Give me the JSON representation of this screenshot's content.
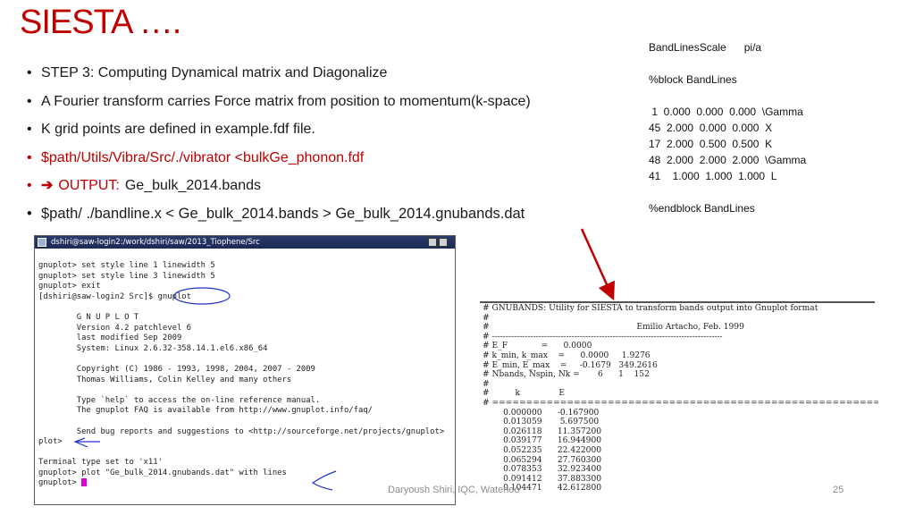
{
  "slide": {
    "title": "SIESTA ….",
    "footer": "Daryoush Shiri, IQC, Waterloo",
    "page_number": "25",
    "accent_color": "#c00000"
  },
  "bullets": [
    "STEP 3: Computing Dynamical matrix and Diagonalize",
    "A Fourier transform carries Force matrix from position to momentum(k-space)",
    "K grid points are defined in example.fdf file.",
    "$path/Utils/Vibra/Src/./vibrator <bulkGe_phonon.fdf",
    "$path/ ./bandline.x < Ge_bulk_2014.bands > Ge_bulk_2014.gnubands.dat"
  ],
  "output_bullet": {
    "arrow_icon": "arrow-right-icon",
    "label": "OUTPUT:",
    "value": "Ge_bulk_2014.bands"
  },
  "fdf_block": {
    "lines": [
      "BandLinesScale      pi/a",
      "",
      "%block BandLines",
      "",
      " 1  0.000  0.000  0.000  \\Gamma",
      "45  2.000  0.000  0.000  X",
      "17  2.000  0.500  0.500  K",
      "48  2.000  2.000  2.000  \\Gamma",
      "41    1.000  1.000  1.000  L",
      "",
      "%endblock BandLines"
    ]
  },
  "terminal": {
    "title": "dshiri@saw-login2:/work/dshiri/saw/2013_Tiophene/Src",
    "lines": [
      "gnuplot> set style line 1 linewidth 5",
      "gnuplot> set style line 3 linewidth 5",
      "gnuplot> exit",
      "[dshiri@saw-login2 Src]$ gnuplot",
      "",
      "        G N U P L O T",
      "        Version 4.2 patchlevel 6",
      "        last modified Sep 2009",
      "        System: Linux 2.6.32-358.14.1.el6.x86_64",
      "",
      "        Copyright (C) 1986 - 1993, 1998, 2004, 2007 - 2009",
      "        Thomas Williams, Colin Kelley and many others",
      "",
      "        Type `help` to access the on-line reference manual.",
      "        The gnuplot FAQ is available from http://www.gnuplot.info/faq/",
      "",
      "        Send bug reports and suggestions to <http://sourceforge.net/projects/gnuplot>",
      "plot>",
      "",
      "Terminal type set to 'x11'",
      "gnuplot> plot \"Ge_bulk_2014.gnubands.dat\" with lines",
      "gnuplot> "
    ]
  },
  "gnubands": {
    "lines": [
      "# GNUBANDS: Utility for SIESTA to transform bands output into Gnuplot format",
      "#",
      "#                                                         Emilio Artacho, Feb. 1999",
      "# ------------------------------------------------------------------------------------",
      "# E_F             =      0.0000",
      "# k_min, k_max    =      0.0000     1.9276",
      "# E_min, E_max    =     -0.1679   349.2616",
      "# Nbands, Nspin, Nk =       6      1    152",
      "#",
      "#          k               E",
      "# ====================================================================================",
      "        0.000000      -0.167900",
      "        0.013059       5.697500",
      "        0.026118      11.357200",
      "        0.039177      16.944900",
      "        0.052235      22.422000",
      "        0.065294      27.760300",
      "        0.078353      32.923400",
      "        0.091412      37.883300",
      "        0.104471      42.612800"
    ]
  }
}
